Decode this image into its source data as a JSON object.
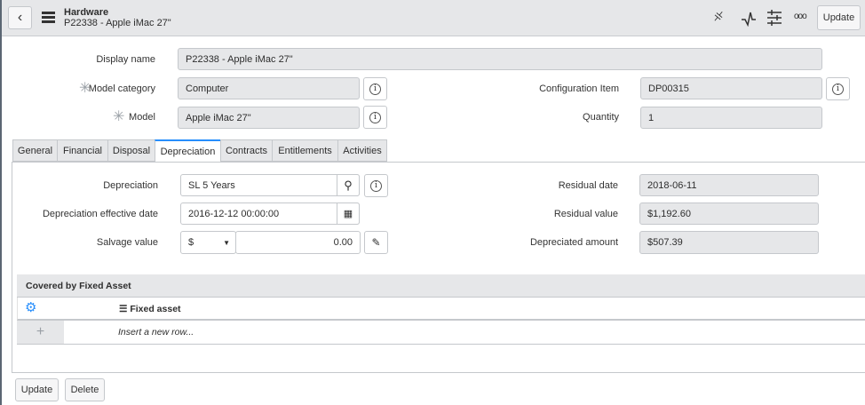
{
  "header": {
    "title": "Hardware",
    "subtitle": "P22338 - Apple iMac 27\"",
    "update_label": "Update"
  },
  "form": {
    "display_name": {
      "label": "Display name",
      "value": "P22338 - Apple iMac 27\""
    },
    "model_category": {
      "label": "Model category",
      "value": "Computer"
    },
    "model": {
      "label": "Model",
      "value": "Apple iMac 27\""
    },
    "configuration_item": {
      "label": "Configuration Item",
      "value": "DP00315"
    },
    "quantity": {
      "label": "Quantity",
      "value": "1"
    }
  },
  "tabs": [
    {
      "label": "General"
    },
    {
      "label": "Financial"
    },
    {
      "label": "Disposal"
    },
    {
      "label": "Depreciation"
    },
    {
      "label": "Contracts"
    },
    {
      "label": "Entitlements"
    },
    {
      "label": "Activities"
    }
  ],
  "depreciation": {
    "depreciation": {
      "label": "Depreciation",
      "value": "SL 5 Years"
    },
    "effective_date": {
      "label": "Depreciation effective date",
      "value": "2016-12-12 00:00:00"
    },
    "salvage": {
      "label": "Salvage value",
      "currency": "$",
      "value": "0.00"
    },
    "residual_date": {
      "label": "Residual date",
      "value": "2018-06-11"
    },
    "residual_value": {
      "label": "Residual value",
      "value": "$1,192.60"
    },
    "depreciated_amount": {
      "label": "Depreciated amount",
      "value": "$507.39"
    }
  },
  "related_list": {
    "title": "Covered by Fixed Asset",
    "column": "Fixed asset",
    "insert_placeholder": "Insert a new row..."
  },
  "footer": {
    "update_label": "Update",
    "delete_label": "Delete"
  },
  "colors": {
    "accent": "#278efc",
    "field_bg": "#e6e7e9"
  }
}
